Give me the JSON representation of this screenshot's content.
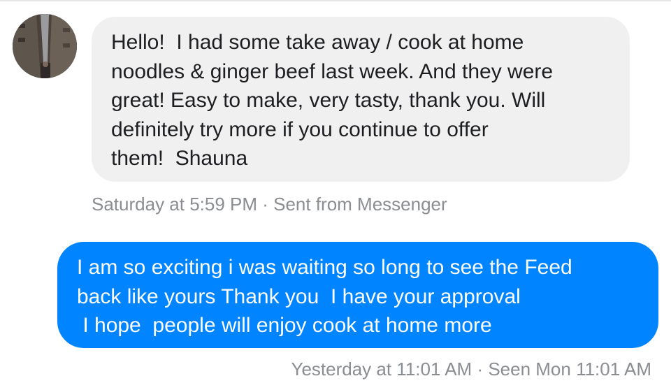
{
  "colors": {
    "incoming_bubble": "#f1f0f0",
    "outgoing_bubble": "#0084ff",
    "meta_text": "#8a8d91"
  },
  "incoming_message": {
    "lines": [
      "Hello!  I had some take away / cook at home",
      "noodles & ginger beef last week. And they were",
      "great! Easy to make, very tasty, thank you. Will",
      "definitely try more if you continue to offer",
      "them!  Shauna"
    ],
    "meta": "Saturday at 5:59 PM · Sent from Messenger"
  },
  "outgoing_message": {
    "lines": [
      "I am so exciting i was waiting so long to see the Feed",
      "back like yours Thank you  I have your approval",
      " I hope  people will enjoy cook at home more"
    ],
    "meta": "Yesterday at 11:01 AM · Seen Mon 11:01 AM"
  }
}
